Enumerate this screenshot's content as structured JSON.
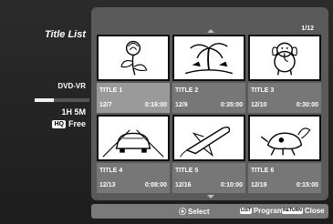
{
  "sidebar": {
    "title": "Title List",
    "disc_type": "DVD-VR",
    "space_fraction_used": 0.35,
    "remaining_time": "1H 5M",
    "quality_badge": "HQ",
    "remaining_label": "Free"
  },
  "grid": {
    "page_counter": "1/12",
    "titles": [
      {
        "name": "TITLE  1",
        "date": "12/7",
        "duration": "0:16:00",
        "thumbnail": "rose-drawing",
        "selected": true
      },
      {
        "name": "TITLE  2",
        "date": "12/9",
        "duration": "0:35:00",
        "thumbnail": "island-palm-drawing",
        "selected": false
      },
      {
        "name": "TITLE  3",
        "date": "12/10",
        "duration": "0:30:00",
        "thumbnail": "elephant-cartoon",
        "selected": false
      },
      {
        "name": "TITLE  4",
        "date": "12/13",
        "duration": "0:08:00",
        "thumbnail": "car-on-road-drawing",
        "selected": false
      },
      {
        "name": "TITLE  5",
        "date": "12/16",
        "duration": "0:10:00",
        "thumbnail": "space-shuttle-drawing",
        "selected": false
      },
      {
        "name": "TITLE  6",
        "date": "12/19",
        "duration": "0:15:00",
        "thumbnail": "dog-cartoon",
        "selected": false
      }
    ]
  },
  "hints": {
    "select_icon": "joystick-icon",
    "select_label": "Select",
    "program_key": "LIST",
    "program_label": "Program",
    "close_key": "RETURN",
    "close_label": "Close"
  }
}
